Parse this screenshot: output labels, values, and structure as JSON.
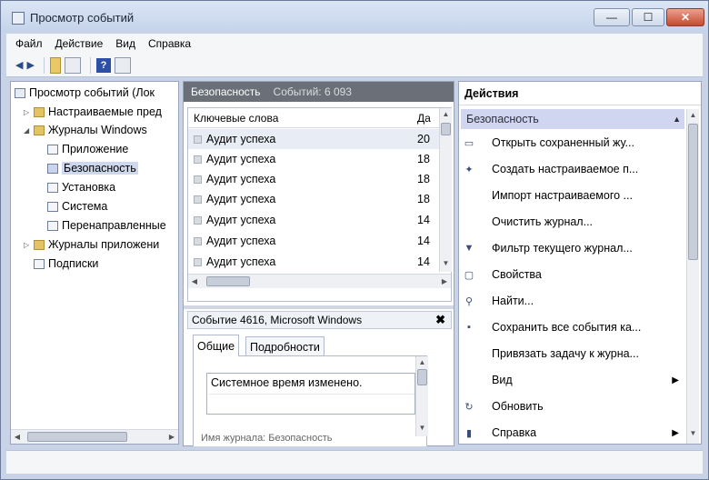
{
  "window": {
    "title": "Просмотр событий",
    "min_symbol": "—",
    "max_symbol": "☐",
    "close_symbol": "✕"
  },
  "menu": [
    "Файл",
    "Действие",
    "Вид",
    "Справка"
  ],
  "toolbar": {
    "back_symbol": "◀",
    "forward_symbol": "▶",
    "help_symbol": "?"
  },
  "tree": {
    "root": "Просмотр событий (Лок",
    "custom_views": "Настраиваемые пред",
    "windows_logs": "Журналы Windows",
    "logs": [
      "Приложение",
      "Безопасность",
      "Установка",
      "Система",
      "Перенаправленные"
    ],
    "app_service_logs": "Журналы приложени",
    "subscriptions": "Подписки"
  },
  "center": {
    "header_title": "Безопасность",
    "header_sub": "Событий: 6 093",
    "col_keywords": "Ключевые слова",
    "col_date": "Да",
    "events": [
      {
        "keyword": "Аудит успеха",
        "date": "20"
      },
      {
        "keyword": "Аудит успеха",
        "date": "18"
      },
      {
        "keyword": "Аудит успеха",
        "date": "18"
      },
      {
        "keyword": "Аудит успеха",
        "date": "18"
      },
      {
        "keyword": "Аудит успеха",
        "date": "14"
      },
      {
        "keyword": "Аудит успеха",
        "date": "14"
      },
      {
        "keyword": "Аудит успеха",
        "date": "14"
      }
    ],
    "detail_title": "Событие 4616, Microsoft Windows",
    "detail_close": "✖",
    "tab_general": "Общие",
    "tab_details": "Подробности",
    "description": "Системное время изменено.",
    "description_cut": "Имя журнала:     Безопасность"
  },
  "actions": {
    "header": "Действия",
    "section": "Безопасность",
    "items": [
      {
        "label": "Открыть сохраненный жу...",
        "icon": "open-saved-log-icon",
        "glyph": "▭",
        "arrow": ""
      },
      {
        "label": "Создать настраиваемое п...",
        "icon": "create-view-icon",
        "glyph": "✦",
        "arrow": ""
      },
      {
        "label": "Импорт настраиваемого ...",
        "icon": "",
        "glyph": "",
        "arrow": ""
      },
      {
        "label": "Очистить журнал...",
        "icon": "",
        "glyph": "",
        "arrow": ""
      },
      {
        "label": "Фильтр текущего журнал...",
        "icon": "filter-icon",
        "glyph": "▼",
        "arrow": ""
      },
      {
        "label": "Свойства",
        "icon": "properties-icon",
        "glyph": "▢",
        "arrow": ""
      },
      {
        "label": "Найти...",
        "icon": "find-icon",
        "glyph": "⚲",
        "arrow": ""
      },
      {
        "label": "Сохранить все события ка...",
        "icon": "save-icon",
        "glyph": "▪",
        "arrow": ""
      },
      {
        "label": "Привязать задачу к журна...",
        "icon": "",
        "glyph": "",
        "arrow": ""
      },
      {
        "label": "Вид",
        "icon": "",
        "glyph": "",
        "arrow": "▶"
      },
      {
        "label": "Обновить",
        "icon": "refresh-icon",
        "glyph": "↻",
        "arrow": ""
      },
      {
        "label": "Справка",
        "icon": "help-icon",
        "glyph": "▮",
        "arrow": "▶"
      }
    ]
  }
}
